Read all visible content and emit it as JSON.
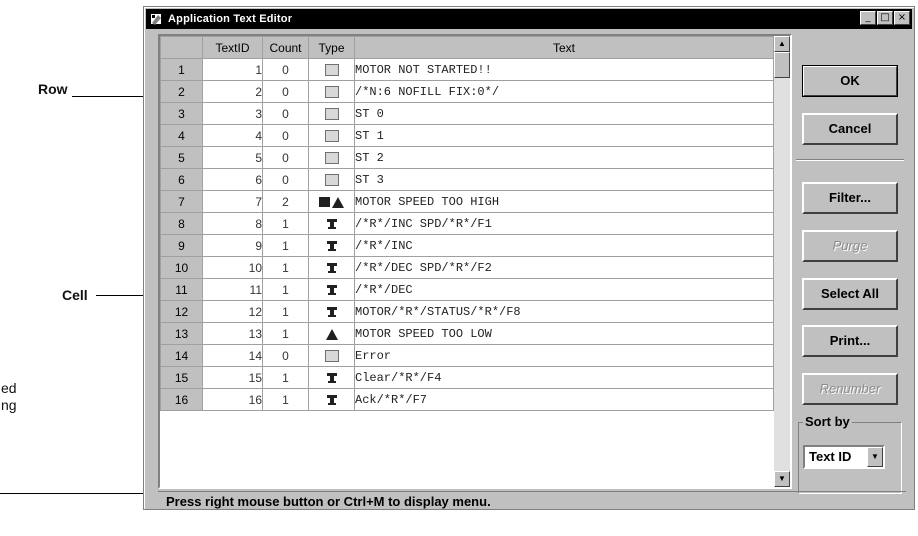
{
  "annotations": {
    "row": "Row",
    "cell": "Cell",
    "partial_top": "ed",
    "partial_bottom": "ng"
  },
  "window": {
    "title": "Application Text Editor",
    "min_label": "_",
    "max_label": "□",
    "close_label": "×"
  },
  "grid": {
    "headers": [
      "",
      "TextID",
      "Count",
      "Type",
      "Text"
    ],
    "rows": [
      {
        "row": "1",
        "id": "1",
        "count": "0",
        "type": "box",
        "text": "MOTOR NOT STARTED!!"
      },
      {
        "row": "2",
        "id": "2",
        "count": "0",
        "type": "box",
        "text": "/*N:6  NOFILL FIX:0*/"
      },
      {
        "row": "3",
        "id": "3",
        "count": "0",
        "type": "box",
        "text": "ST 0"
      },
      {
        "row": "4",
        "id": "4",
        "count": "0",
        "type": "box",
        "text": "ST 1"
      },
      {
        "row": "5",
        "id": "5",
        "count": "0",
        "type": "box",
        "text": "ST 2"
      },
      {
        "row": "6",
        "id": "6",
        "count": "0",
        "type": "box",
        "text": "ST 3"
      },
      {
        "row": "7",
        "id": "7",
        "count": "2",
        "type": "multi",
        "text": "MOTOR SPEED TOO HIGH"
      },
      {
        "row": "8",
        "id": "8",
        "count": "1",
        "type": "tool",
        "text": "/*R*/INC SPD/*R*/F1"
      },
      {
        "row": "9",
        "id": "9",
        "count": "1",
        "type": "tool",
        "text": "/*R*/INC"
      },
      {
        "row": "10",
        "id": "10",
        "count": "1",
        "type": "tool",
        "text": "/*R*/DEC SPD/*R*/F2"
      },
      {
        "row": "11",
        "id": "11",
        "count": "1",
        "type": "tool",
        "text": "/*R*/DEC"
      },
      {
        "row": "12",
        "id": "12",
        "count": "1",
        "type": "tool",
        "text": "MOTOR/*R*/STATUS/*R*/F8"
      },
      {
        "row": "13",
        "id": "13",
        "count": "1",
        "type": "alarm",
        "text": "MOTOR SPEED TOO LOW"
      },
      {
        "row": "14",
        "id": "14",
        "count": "0",
        "type": "box",
        "text": "Error"
      },
      {
        "row": "15",
        "id": "15",
        "count": "1",
        "type": "tool",
        "text": "Clear/*R*/F4"
      },
      {
        "row": "16",
        "id": "16",
        "count": "1",
        "type": "tool",
        "text": "Ack/*R*/F7"
      }
    ]
  },
  "buttons": {
    "ok": "OK",
    "cancel": "Cancel",
    "filter": "Filter...",
    "purge": "Purge",
    "select_all": "Select All",
    "print": "Print...",
    "renumber": "Renumber"
  },
  "sort": {
    "label": "Sort by",
    "value": "Text ID"
  },
  "status": "Press right mouse button or Ctrl+M to display menu."
}
